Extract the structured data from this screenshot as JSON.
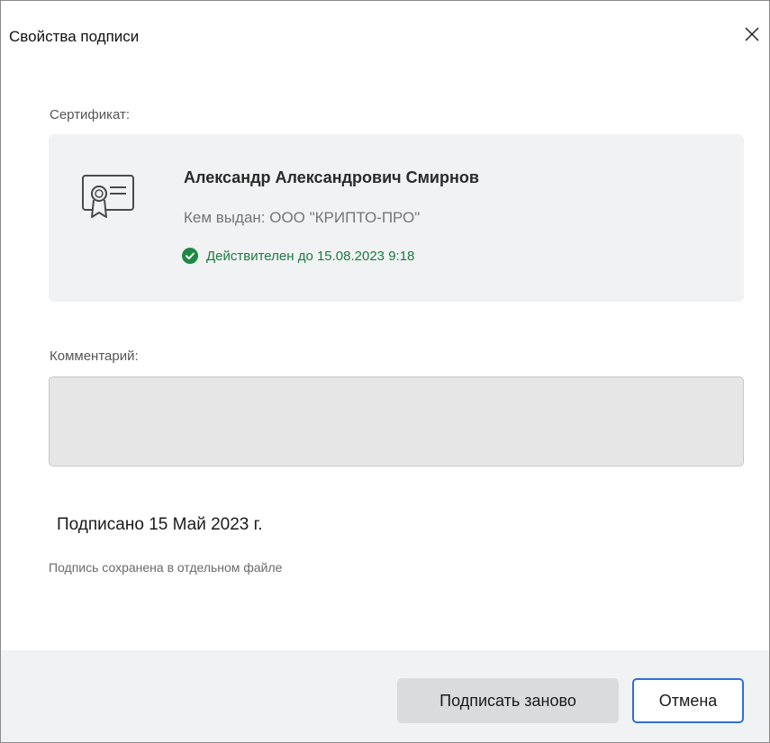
{
  "dialog": {
    "title": "Свойства подписи",
    "close_icon": "close-icon"
  },
  "certificate": {
    "section_label": "Сертификат:",
    "icon": "certificate-icon",
    "owner_name": "Александр Александрович Смирнов",
    "issuer": "Кем выдан: ООО \"КРИПТО-ПРО\"",
    "validity": "Действителен до 15.08.2023 9:18",
    "validity_icon": "check-circle-icon",
    "validity_color": "#1c7a3d"
  },
  "comment": {
    "section_label": "Комментарий:",
    "value": ""
  },
  "signature": {
    "signed_date": "Подписано 15 Май 2023 г.",
    "storage_note": "Подпись сохранена в отдельном файле"
  },
  "footer": {
    "resign_label": "Подписать заново",
    "cancel_label": "Отмена",
    "accent_color": "#2f6fd6"
  }
}
